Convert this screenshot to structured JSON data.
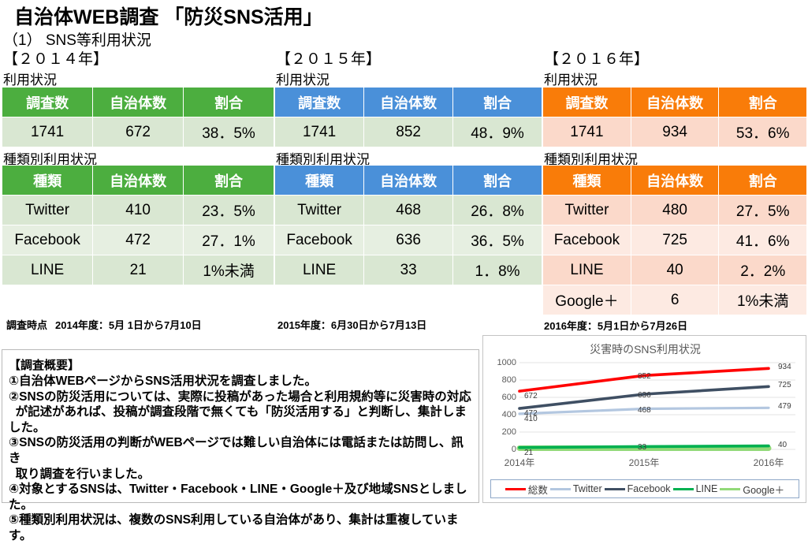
{
  "document": {
    "title": "自治体WEB調査 「防災SNS活用」",
    "subtitle": "（1） SNS等利用状況"
  },
  "sections": {
    "y2014": {
      "year_label": "【２０１４年】",
      "usage_label": "利用状況",
      "bytype_label": "種類別利用状況",
      "usage_headers": [
        "調査数",
        "自治体数",
        "割合"
      ],
      "usage_row": [
        "1741",
        "672",
        "38．5%"
      ],
      "bytype_headers": [
        "種類",
        "自治体数",
        "割合"
      ],
      "bytype_rows": [
        [
          "Twitter",
          "410",
          "23．5%"
        ],
        [
          "Facebook",
          "472",
          "27．1%"
        ],
        [
          "LINE",
          "21",
          "1%未満"
        ]
      ],
      "date_prefix": "調査時点",
      "date_note": "2014年度：5月 1日から7月10日"
    },
    "y2015": {
      "year_label": "【２０１５年】",
      "usage_label": "利用状況",
      "bytype_label": "種類別利用状況",
      "usage_headers": [
        "調査数",
        "自治体数",
        "割合"
      ],
      "usage_row": [
        "1741",
        "852",
        "48．9%"
      ],
      "bytype_headers": [
        "種類",
        "自治体数",
        "割合"
      ],
      "bytype_rows": [
        [
          "Twitter",
          "468",
          "26．8%"
        ],
        [
          "Facebook",
          "636",
          "36．5%"
        ],
        [
          "LINE",
          "33",
          "1．8%"
        ]
      ],
      "date_note": "2015年度：6月30日から7月13日"
    },
    "y2016": {
      "year_label": "【２０１６年】",
      "usage_label": "利用状況",
      "bytype_label": "種類別利用状況",
      "usage_headers": [
        "調査数",
        "自治体数",
        "割合"
      ],
      "usage_row": [
        "1741",
        "934",
        "53．6%"
      ],
      "bytype_headers": [
        "種類",
        "自治体数",
        "割合"
      ],
      "bytype_rows": [
        [
          "Twitter",
          "480",
          "27．5%"
        ],
        [
          "Facebook",
          "725",
          "41．6%"
        ],
        [
          "LINE",
          "40",
          "2．2%"
        ],
        [
          "Google＋",
          "6",
          "1%未満"
        ]
      ],
      "date_note": "2016年度：5月1日から7月26日"
    }
  },
  "outline": {
    "heading": "【調査概要】",
    "items": [
      "①自治体WEBページからSNS活用状況を調査しました。",
      "②SNSの防災活用については、実際に投稿があった場合と利用規約等に災害時の対応\n  が記述があれば、投稿が調査段階で無くても「防災活用する」と判断し、集計しました。",
      "③SNSの防災活用の判断がWEBページでは難しい自治体には電話または訪問し、訊き\n  取り調査を行いました。",
      "④対象とするSNSは、Twitter・Facebook・LINE・Google＋及び地域SNSとしました。",
      "⑤種類別利用状況は、複数のSNS利用している自治体があり、集計は重複しています。"
    ]
  },
  "chart_data": {
    "type": "line",
    "title": "災害時のSNS利用状況",
    "xlabel": "",
    "ylabel": "",
    "categories": [
      "2014年",
      "2015年",
      "2016年"
    ],
    "ylim": [
      0,
      1000
    ],
    "yticks": [
      0,
      200,
      400,
      600,
      800,
      1000
    ],
    "grid": true,
    "legend_position": "bottom",
    "series": [
      {
        "name": "総数",
        "color": "#ff0000",
        "values": [
          672,
          852,
          934
        ],
        "labels": [
          "672",
          "852",
          "934"
        ]
      },
      {
        "name": "Twitter",
        "color": "#b3c7e0",
        "values": [
          410,
          468,
          479
        ],
        "labels": [
          "410",
          "468",
          "479"
        ]
      },
      {
        "name": "Facebook",
        "color": "#3f4f63",
        "values": [
          472,
          636,
          725
        ],
        "labels": [
          "472",
          "636",
          "725"
        ]
      },
      {
        "name": "LINE",
        "color": "#00b050",
        "values": [
          21,
          33,
          40
        ],
        "labels": [
          "21",
          "33",
          "40"
        ]
      },
      {
        "name": "Google＋",
        "color": "#92d978",
        "values": [
          0,
          0,
          0
        ],
        "labels": [
          "",
          "",
          ""
        ]
      }
    ]
  }
}
